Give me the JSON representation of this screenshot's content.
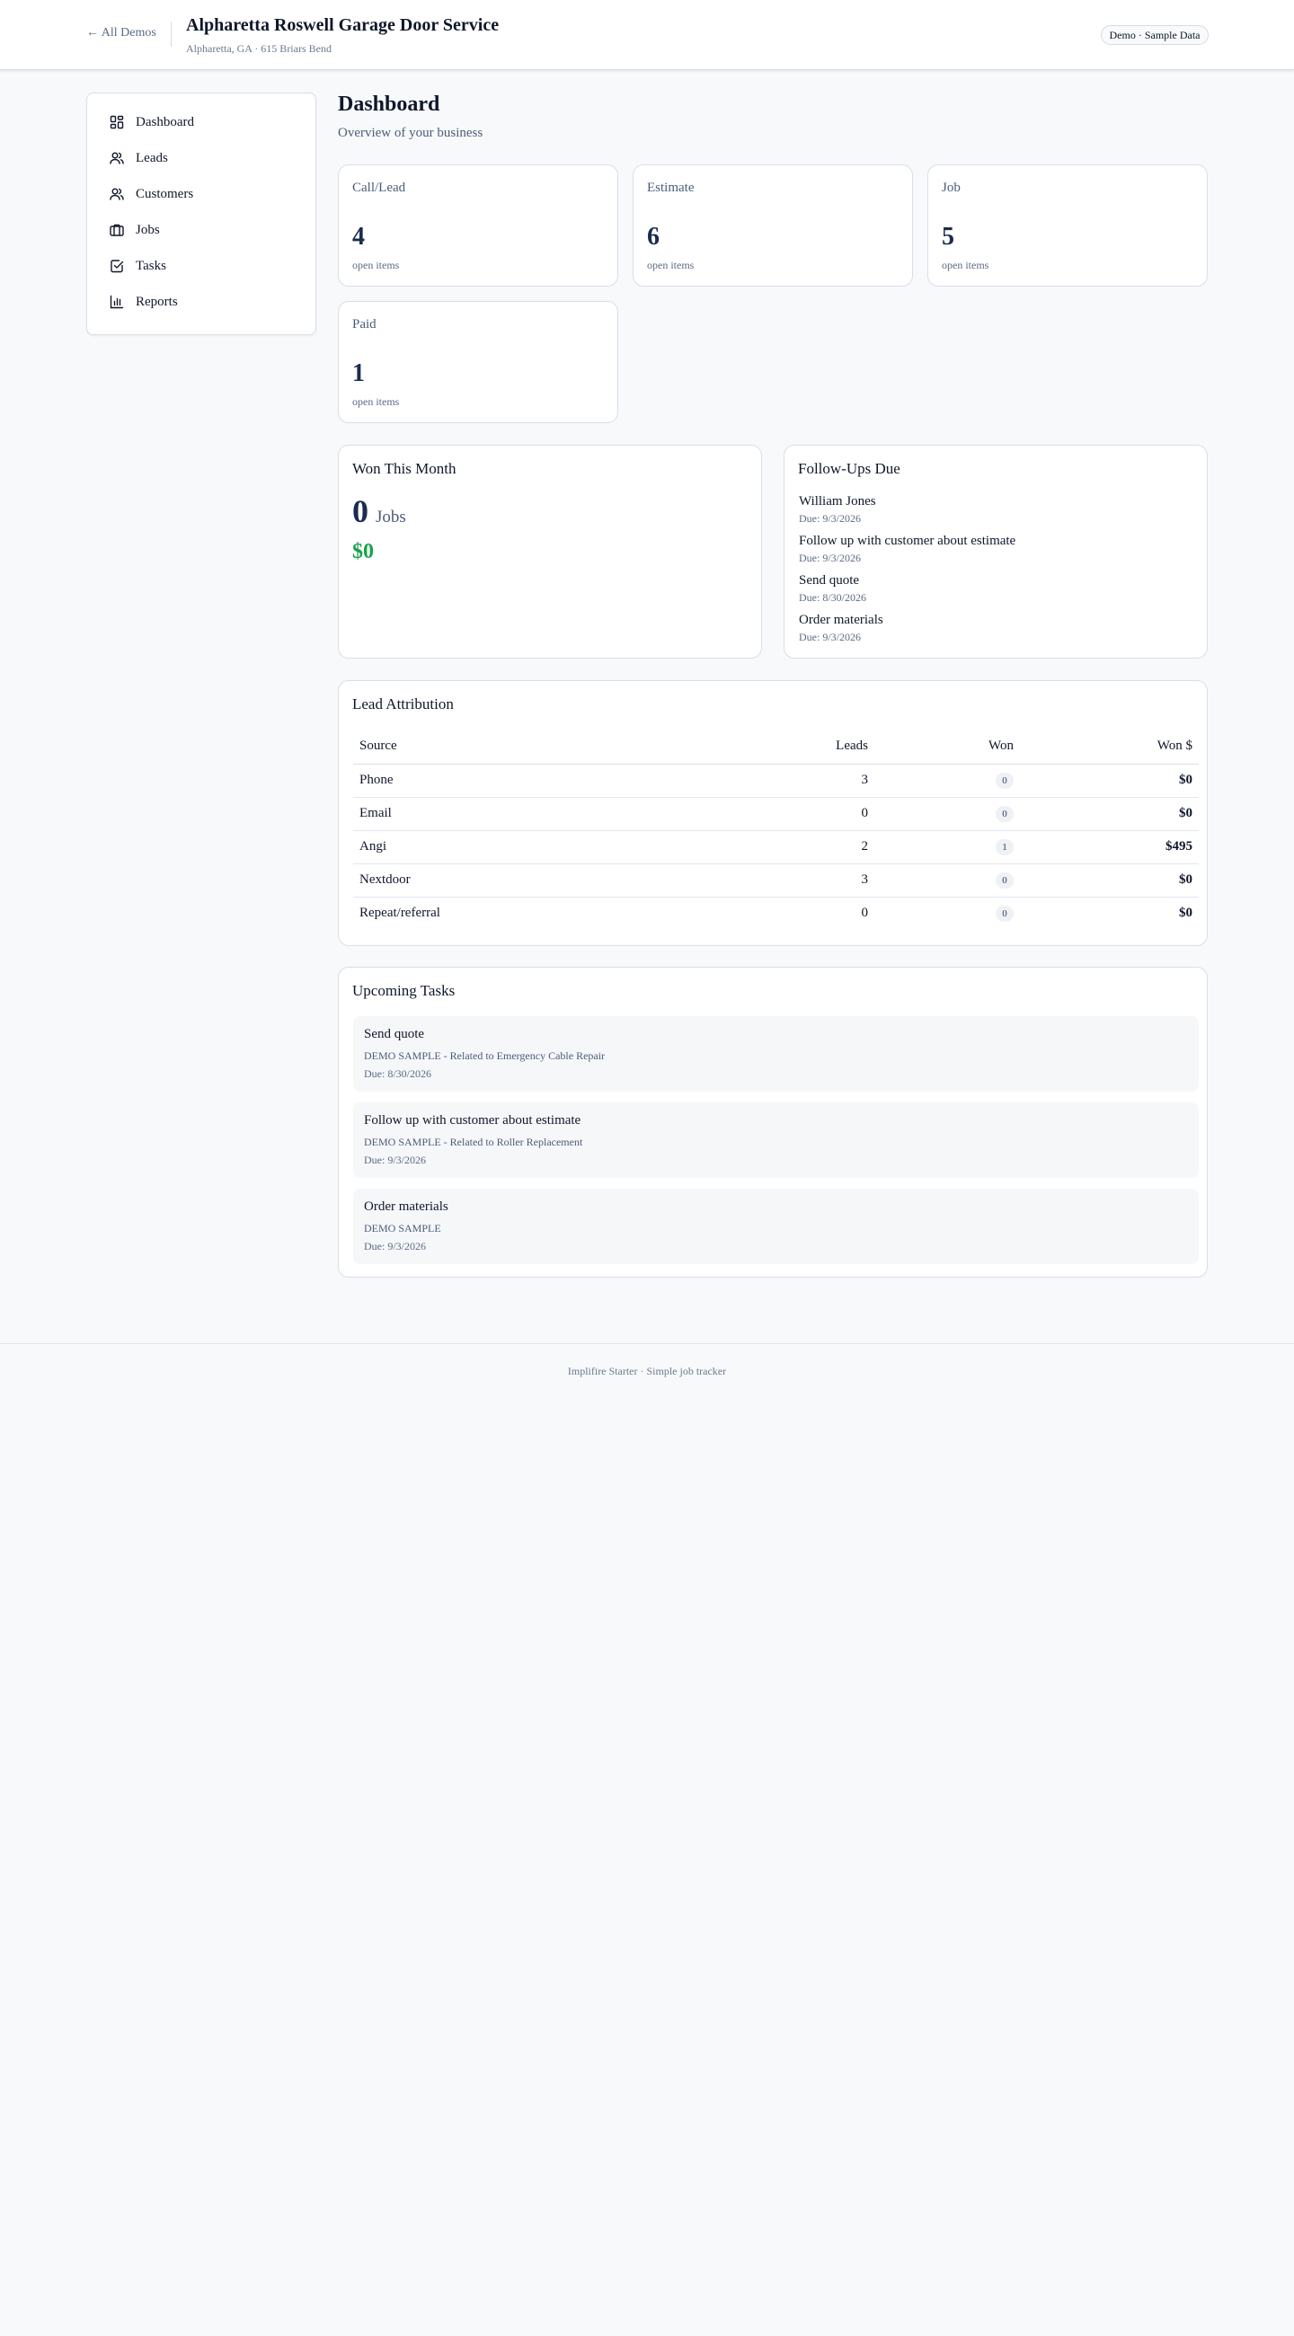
{
  "header": {
    "back_link": "← All Demos",
    "business_name": "Alpharetta Roswell Garage Door Service",
    "address": "Alpharetta, GA · 615 Briars Bend",
    "badge": "Demo · Sample Data"
  },
  "sidebar": {
    "items": [
      {
        "label": "Dashboard",
        "icon": "dashboard-icon"
      },
      {
        "label": "Leads",
        "icon": "users-icon"
      },
      {
        "label": "Customers",
        "icon": "users-icon"
      },
      {
        "label": "Jobs",
        "icon": "briefcase-icon"
      },
      {
        "label": "Tasks",
        "icon": "checkbox-icon"
      },
      {
        "label": "Reports",
        "icon": "bar-chart-icon"
      }
    ]
  },
  "page": {
    "title": "Dashboard",
    "subtitle": "Overview of your business"
  },
  "stats": [
    {
      "label": "Call/Lead",
      "value": "4",
      "caption": "open items"
    },
    {
      "label": "Estimate",
      "value": "6",
      "caption": "open items"
    },
    {
      "label": "Job",
      "value": "5",
      "caption": "open items"
    },
    {
      "label": "Paid",
      "value": "1",
      "caption": "open items"
    }
  ],
  "won_this_month": {
    "title": "Won This Month",
    "count": "0",
    "unit": "Jobs",
    "amount": "$0"
  },
  "follow_ups": {
    "title": "Follow-Ups Due",
    "items": [
      {
        "name": "William Jones",
        "due": "Due: 9/3/2026"
      },
      {
        "name": "Follow up with customer about estimate",
        "due": "Due: 9/3/2026"
      },
      {
        "name": "Send quote",
        "due": "Due: 8/30/2026"
      },
      {
        "name": "Order materials",
        "due": "Due: 9/3/2026"
      }
    ]
  },
  "lead_attribution": {
    "title": "Lead Attribution",
    "columns": [
      "Source",
      "Leads",
      "Won",
      "Won $"
    ],
    "rows": [
      {
        "source": "Phone",
        "leads": "3",
        "won": "0",
        "won_amount": "$0"
      },
      {
        "source": "Email",
        "leads": "0",
        "won": "0",
        "won_amount": "$0"
      },
      {
        "source": "Angi",
        "leads": "2",
        "won": "1",
        "won_amount": "$495"
      },
      {
        "source": "Nextdoor",
        "leads": "3",
        "won": "0",
        "won_amount": "$0"
      },
      {
        "source": "Repeat/referral",
        "leads": "0",
        "won": "0",
        "won_amount": "$0"
      }
    ]
  },
  "upcoming_tasks": {
    "title": "Upcoming Tasks",
    "items": [
      {
        "title": "Send quote",
        "related": "DEMO SAMPLE - Related to Emergency Cable Repair",
        "due": "Due: 8/30/2026"
      },
      {
        "title": "Follow up with customer about estimate",
        "related": "DEMO SAMPLE - Related to Roller Replacement",
        "due": "Due: 9/3/2026"
      },
      {
        "title": "Order materials",
        "related": "DEMO SAMPLE",
        "due": "Due: 9/3/2026"
      }
    ]
  },
  "footer": {
    "text": "Implifire Starter · Simple job tracker"
  },
  "colors": {
    "accent_green": "#16a34a",
    "background": "#f8f9fb",
    "card_border": "#d9dee6"
  }
}
